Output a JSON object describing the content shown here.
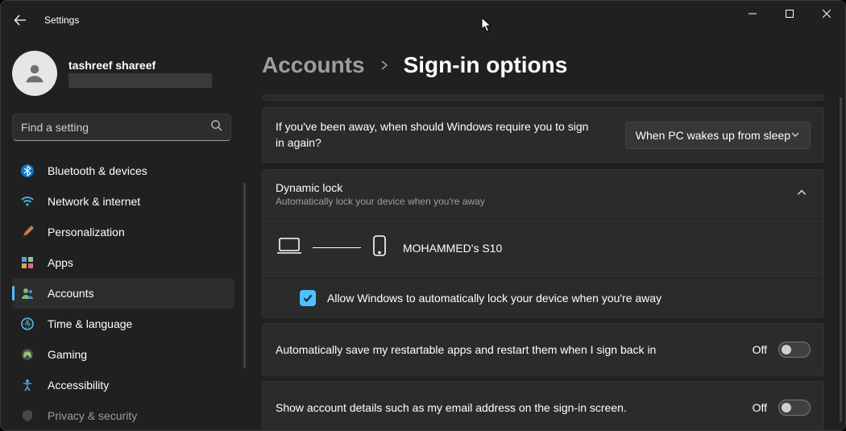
{
  "app": {
    "title": "Settings"
  },
  "profile": {
    "name": "tashreef shareef"
  },
  "search": {
    "placeholder": "Find a setting"
  },
  "sidebar": {
    "items": [
      {
        "label": "Bluetooth & devices"
      },
      {
        "label": "Network & internet"
      },
      {
        "label": "Personalization"
      },
      {
        "label": "Apps"
      },
      {
        "label": "Accounts"
      },
      {
        "label": "Time & language"
      },
      {
        "label": "Gaming"
      },
      {
        "label": "Accessibility"
      },
      {
        "label": "Privacy & security"
      }
    ],
    "active_index": 4
  },
  "breadcrumb": {
    "parent": "Accounts",
    "current": "Sign-in options"
  },
  "signin_prompt": {
    "label": "If you've been away, when should Windows require you to sign in again?",
    "dropdown_value": "When PC wakes up from sleep"
  },
  "dynamic_lock": {
    "title": "Dynamic lock",
    "subtitle": "Automatically lock your device when you're away",
    "paired_device": "MOHAMMED's S10",
    "checkbox_label": "Allow Windows to automatically lock your device when you're away",
    "checkbox_checked": true
  },
  "toggles": [
    {
      "label": "Automatically save my restartable apps and restart them when I sign back in",
      "state": "Off"
    },
    {
      "label": "Show account details such as my email address on the sign-in screen.",
      "state": "Off"
    }
  ]
}
